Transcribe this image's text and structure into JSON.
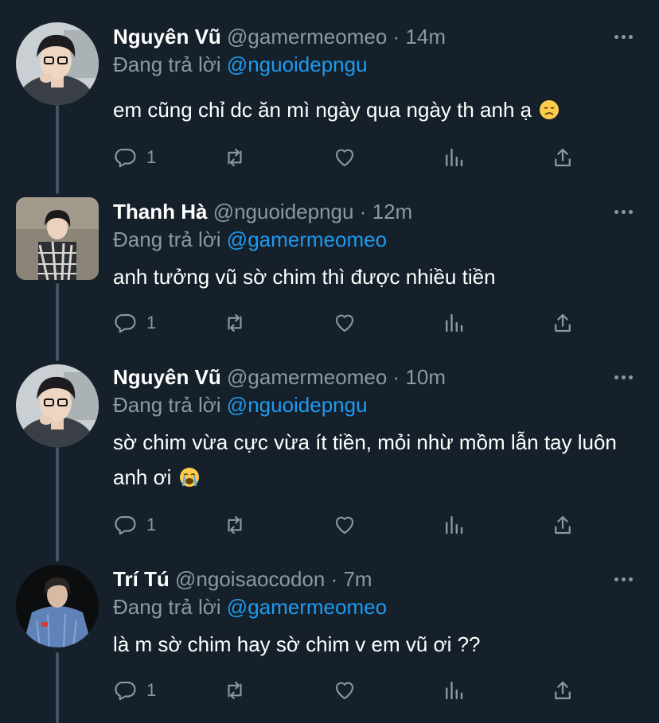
{
  "tweets": [
    {
      "name": "Nguyên Vũ",
      "handle": "@gamermeomeo",
      "separator": "·",
      "time": "14m",
      "replying_prefix": "Đang trả lời",
      "replying_to": "@nguoidepngu",
      "text": "em cũng chỉ dc ăn mì ngày qua ngày th anh ạ",
      "emoji": "disappointed-face",
      "reply_count": "1"
    },
    {
      "name": "Thanh Hà",
      "handle": "@nguoidepngu",
      "separator": "·",
      "time": "12m",
      "replying_prefix": "Đang trả lời",
      "replying_to": "@gamermeomeo",
      "text": "anh tưởng vũ sờ chim thì được nhiều tiền",
      "reply_count": "1"
    },
    {
      "name": "Nguyên Vũ",
      "handle": "@gamermeomeo",
      "separator": "·",
      "time": "10m",
      "replying_prefix": "Đang trả lời",
      "replying_to": "@nguoidepngu",
      "text": "sờ chim vừa cực vừa ít tiền, mỏi nhừ mồm lẫn tay luôn anh ơi",
      "emoji": "loudly-crying-face",
      "reply_count": "1"
    },
    {
      "name": "Trí Tú",
      "handle": "@ngoisaocodon",
      "separator": "·",
      "time": "7m",
      "replying_prefix": "Đang trả lời",
      "replying_to": "@gamermeomeo",
      "text": "là m sờ chim hay sờ chim v em vũ ơi ??",
      "reply_count": "1"
    }
  ],
  "colors": {
    "background": "#15202b",
    "text": "#ffffff",
    "secondary": "#8b98a5",
    "accent": "#1d9bf0",
    "thread_line": "#3d5466"
  },
  "icons": {
    "reply": "reply-icon",
    "retweet": "retweet-icon",
    "like": "heart-icon",
    "views": "analytics-icon",
    "share": "share-icon",
    "more": "more-icon"
  }
}
